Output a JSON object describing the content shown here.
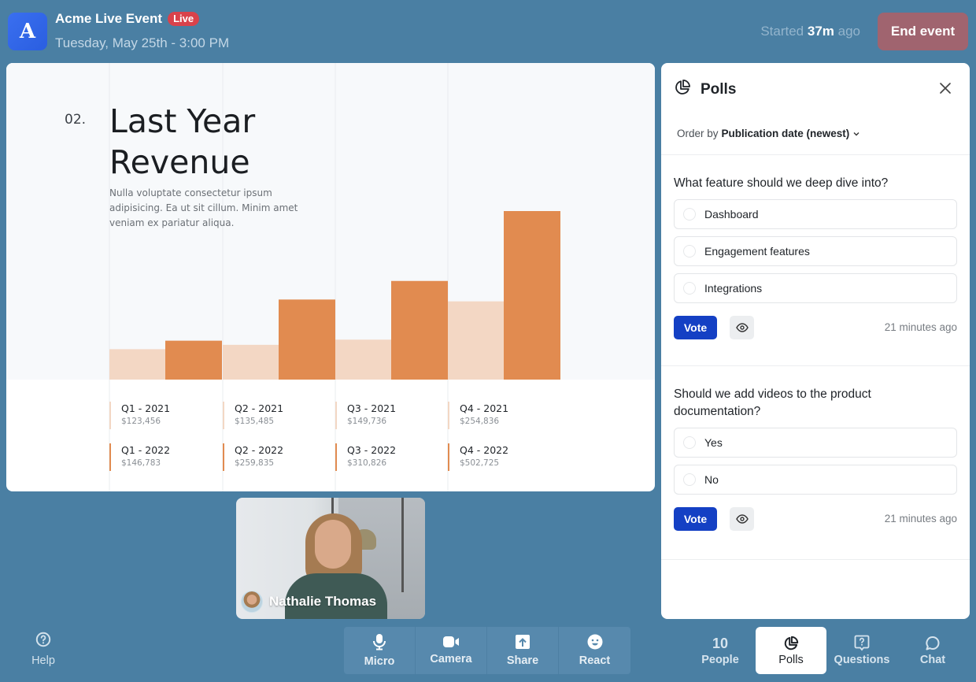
{
  "header": {
    "logo_letter": "A",
    "event_title": "Acme Live Event",
    "live_badge": "Live",
    "event_date": "Tuesday, May 25th - 3:00 PM",
    "started_prefix": "Started",
    "started_value": "37m",
    "started_suffix": "ago",
    "end_button": "End event"
  },
  "colors": {
    "background": "#4a7fa3",
    "live_badge": "#d9424b",
    "end_button": "#a0646f",
    "vote_button": "#1440c4",
    "bar_2021": "#f3d7c4",
    "bar_2022": "#e18b50"
  },
  "slide": {
    "number": "02.",
    "title": "Last Year Revenue",
    "description": "Nulla voluptate consectetur ipsum adipisicing. Ea ut sit cillum. Minim amet veniam ex pariatur aliqua."
  },
  "chart_data": {
    "type": "bar",
    "title": "Last Year Revenue",
    "xlabel": "",
    "ylabel": "",
    "categories": [
      "Q1",
      "Q2",
      "Q3",
      "Q4"
    ],
    "series": [
      {
        "name": "2021",
        "color": "#f3d7c4",
        "labels": [
          "Q1 - 2021",
          "Q2 - 2021",
          "Q3 - 2021",
          "Q4 - 2021"
        ],
        "display": [
          "$123,456",
          "$135,485",
          "$149,736",
          "$254,836"
        ],
        "values": [
          123456,
          135485,
          149736,
          254836
        ]
      },
      {
        "name": "2022",
        "color": "#e18b50",
        "labels": [
          "Q1 - 2022",
          "Q2 - 2022",
          "Q3 - 2022",
          "Q4 - 2022"
        ],
        "display": [
          "$146,783",
          "$259,835",
          "$310,826",
          "$502,725"
        ],
        "values": [
          146783,
          259835,
          310826,
          502725
        ]
      }
    ],
    "ylim": [
      40000,
      502725
    ],
    "grid": "vertical",
    "legend": "none"
  },
  "video": {
    "participant_name": "Nathalie Thomas"
  },
  "polls_panel": {
    "title": "Polls",
    "order_prefix": "Order by",
    "order_value": "Publication date (newest)",
    "polls": [
      {
        "question": "What feature should we deep dive into?",
        "options": [
          "Dashboard",
          "Engagement features",
          "Integrations"
        ],
        "vote_label": "Vote",
        "time": "21 minutes ago"
      },
      {
        "question": "Should we add videos to the product documentation?",
        "options": [
          "Yes",
          "No"
        ],
        "vote_label": "Vote",
        "time": "21 minutes ago"
      }
    ]
  },
  "bottom_bar": {
    "help": "Help",
    "controls": [
      {
        "label": "Micro",
        "icon": "microphone-icon"
      },
      {
        "label": "Camera",
        "icon": "camera-icon"
      },
      {
        "label": "Share",
        "icon": "share-icon"
      },
      {
        "label": "React",
        "icon": "smiley-icon"
      }
    ],
    "people_count": "10",
    "people_label": "People",
    "polls_label": "Polls",
    "questions_label": "Questions",
    "chat_label": "Chat"
  }
}
